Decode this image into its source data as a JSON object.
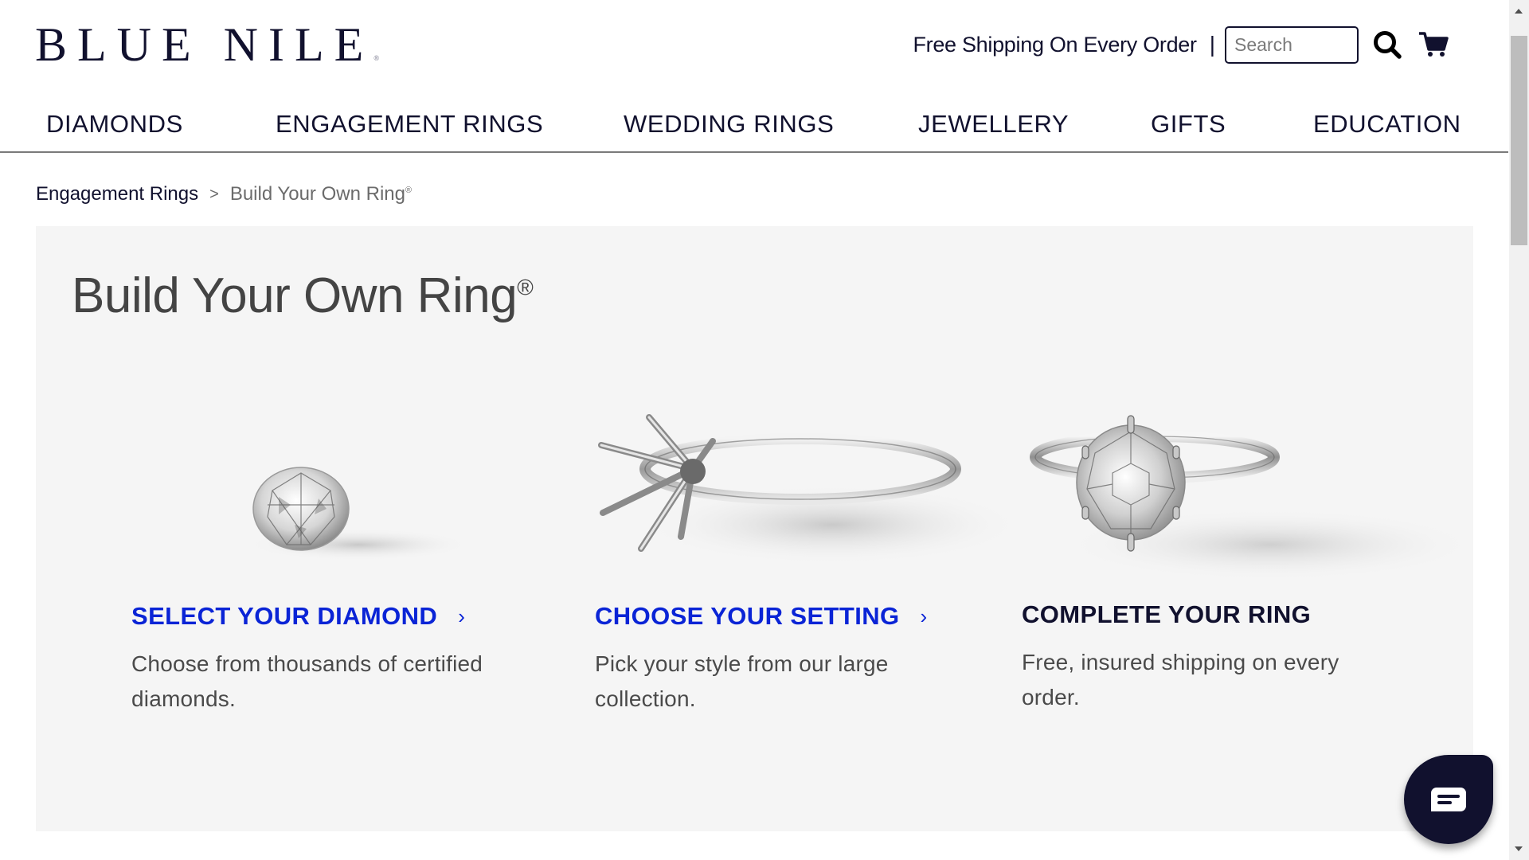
{
  "header": {
    "logo": "BLUE NILE",
    "logo_mark": "®",
    "promo": "Free Shipping On Every Order",
    "separator": "|",
    "search": {
      "placeholder": "Search",
      "value": ""
    },
    "icons": {
      "search": "search-icon",
      "cart": "cart-icon"
    }
  },
  "nav": {
    "items": [
      {
        "label": "DIAMONDS"
      },
      {
        "label": "ENGAGEMENT RINGS"
      },
      {
        "label": "WEDDING RINGS"
      },
      {
        "label": "JEWELLERY"
      },
      {
        "label": "GIFTS"
      },
      {
        "label": "EDUCATION"
      }
    ]
  },
  "breadcrumb": {
    "items": [
      {
        "label": "Engagement Rings"
      },
      {
        "label": "Build Your Own Ring",
        "mark": "®"
      }
    ],
    "separator": ">"
  },
  "main": {
    "title": "Build Your Own Ring",
    "title_mark": "®",
    "steps": [
      {
        "heading": "SELECT YOUR DIAMOND",
        "description_line1": "Choose from thousands of certified",
        "description_line2": "diamonds.",
        "image": "loose-diamond-image",
        "is_link": true
      },
      {
        "heading": "CHOOSE YOUR SETTING",
        "description_line1": "Pick your style from our large",
        "description_line2": "collection.",
        "image": "ring-setting-image",
        "is_link": true
      },
      {
        "heading": "COMPLETE YOUR RING",
        "description_line1": "Free, insured shipping on every",
        "description_line2": "order.",
        "image": "complete-ring-image",
        "is_link": false
      }
    ],
    "chevron": "›"
  },
  "chat": {
    "icon": "chat-icon"
  },
  "colors": {
    "brand_navy": "#11112e",
    "link_blue": "#0a24d6",
    "panel_bg": "#f5f5f5",
    "body_text": "#4a4a4a"
  }
}
